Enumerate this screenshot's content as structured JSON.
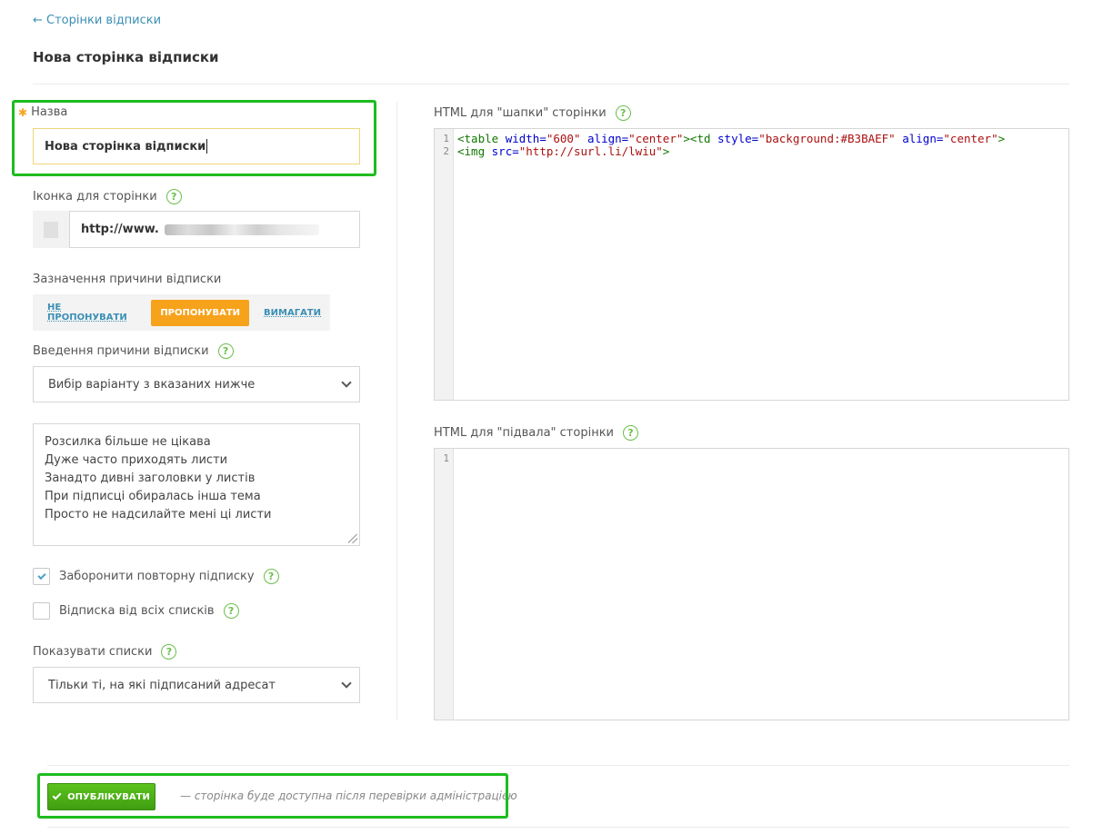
{
  "nav": {
    "back_label": "← Сторінки відписки"
  },
  "page": {
    "title": "Нова сторінка відписки"
  },
  "form": {
    "name": {
      "label": "Назва",
      "required_mark": "✱",
      "value": "Нова сторінка відписки"
    },
    "icon": {
      "label": "Іконка для сторінки",
      "help": "?",
      "url_visible": "http://www."
    },
    "reason_mode": {
      "label": "Зазначення причини відписки",
      "options": [
        "Не пропонувати",
        "Пропонувати",
        "Вимагати"
      ],
      "selected": "Пропонувати"
    },
    "reason_input": {
      "label": "Введення причини відписки",
      "help": "?",
      "selected": "Вибір варіанту з вказаних нижче"
    },
    "reasons_text": [
      "Розсилка більше не цікава",
      "Дуже часто приходять листи",
      "Занадто дивні заголовки у листів",
      "При підписці обиралась інша тема",
      "Просто не надсилайте мені ці листи"
    ],
    "forbid_resubscribe": {
      "label": "Заборонити повторну підписку",
      "checked": true,
      "help": "?"
    },
    "unsubscribe_all": {
      "label": "Відписка від всіх списків",
      "checked": false,
      "help": "?"
    },
    "show_lists": {
      "label": "Показувати списки",
      "help": "?",
      "selected": "Тільки ті, на які підписаний адресат"
    }
  },
  "header_html": {
    "label": "HTML для \"шапки\" сторінки",
    "help": "?",
    "line_numbers": [
      "1",
      "2"
    ]
  },
  "footer_html": {
    "label": "HTML для \"підвала\" сторінки",
    "help": "?",
    "line_numbers": [
      "1"
    ]
  },
  "actions": {
    "publish_label": "Опублікувати",
    "publish_note": "— сторінка буде доступна після перевірки адміністрацією"
  },
  "colors": {
    "accent_orange": "#f7a21b",
    "link_blue": "#3b8fb5",
    "publish_green": "#4caf1a",
    "highlight_green": "#1ebc1e"
  }
}
